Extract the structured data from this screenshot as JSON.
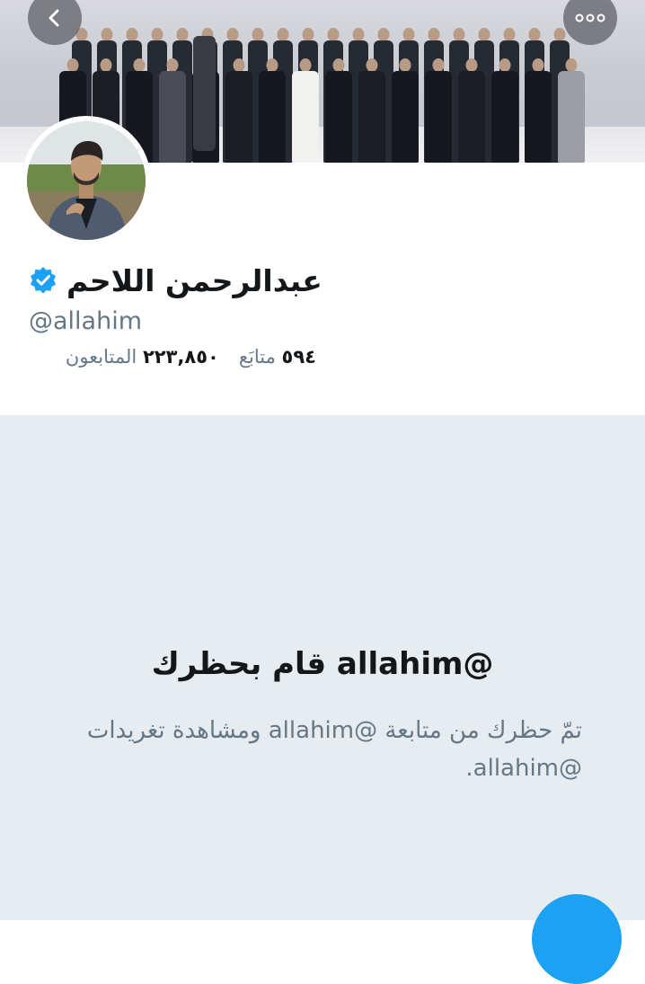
{
  "profile": {
    "display_name": "عبدالرحمن اللاحم",
    "handle": "@allahim",
    "verified": true,
    "following_count": "٥٩٤",
    "following_label": "متابَع",
    "followers_count": "٢٢٣,٨٥٠",
    "followers_label": "المتابعون"
  },
  "blocked": {
    "title": "@allahim قام بحظرك",
    "description_line1": "تمّ حظرك من متابعة @allahim ومشاهدة تغريدات",
    "description_line2": "@allahim."
  },
  "icons": {
    "back": "chevron-left-icon",
    "more": "more-options-icon",
    "verified": "verified-badge-icon",
    "compose": "compose-fab"
  },
  "colors": {
    "accent": "#1da1f2",
    "text_primary": "#14171a",
    "text_secondary": "#657786",
    "blocked_background": "#e6ecf0"
  }
}
